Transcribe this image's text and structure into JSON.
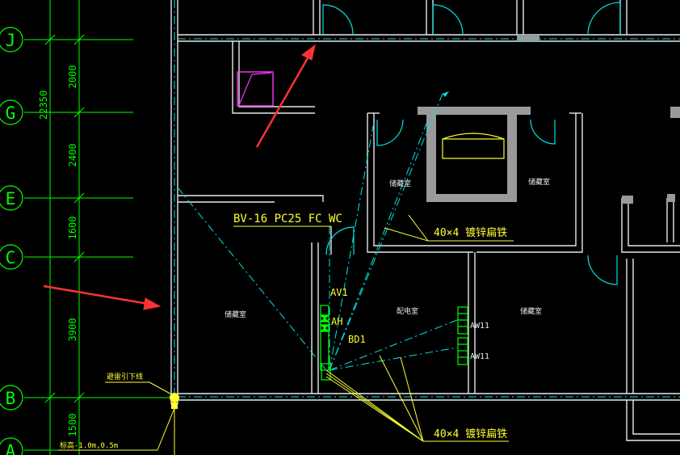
{
  "colors": {
    "background": "#000000",
    "grid_line": "#00ff00",
    "wall": "#e8e8e8",
    "wall_fill": "#9a9a9a",
    "door": "#00e5e5",
    "cable": "#00e5e5",
    "annotation": "#ffff33",
    "equipment": "#00ff00",
    "magenta": "#ff33ff",
    "arrow": "#ff3333"
  },
  "axes": [
    {
      "label": "J"
    },
    {
      "label": "G"
    },
    {
      "label": "E"
    },
    {
      "label": "C"
    },
    {
      "label": "B"
    },
    {
      "label": "A"
    }
  ],
  "dimensions": {
    "total": "22350",
    "segments": [
      "2000",
      "2400",
      "1600",
      "3900",
      "1500"
    ]
  },
  "annotations": {
    "cable_spec": "BV-16 PC25 FC WC",
    "flat_steel_upper": "40×4 镀锌扁铁",
    "flat_steel_lower": "40×4 镀锌扁铁",
    "lightning_down": "避雷引下线",
    "elevation": "标高-1.0m,0.5m"
  },
  "equipment": {
    "av1": "AV1",
    "ah": "AH",
    "bd1": "BD1",
    "aw11_top": "AW11",
    "aw11_bottom": "AW11"
  },
  "rooms": {
    "storage_top": "储藏室",
    "storage_top_right": "储藏室",
    "storage_left": "储藏室",
    "distribution": "配电室",
    "storage_right": "储藏室"
  },
  "icons": {
    "annotation_arrows": "arrow-icon",
    "grounding_point": "grounding-point-icon"
  }
}
